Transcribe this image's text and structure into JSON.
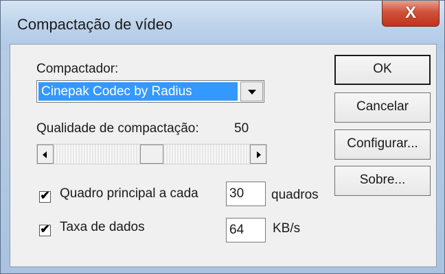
{
  "window": {
    "title": "Compactação de vídeo",
    "close_glyph": "X"
  },
  "compressor": {
    "label": "Compactador:",
    "selected": "Cinepak Codec by Radius"
  },
  "quality": {
    "label": "Qualidade de compactação:",
    "value": "50",
    "slider_fraction": 0.5
  },
  "keyframe": {
    "checked": true,
    "label": "Quadro principal a cada",
    "value": "30",
    "unit": "quadros"
  },
  "datarate": {
    "checked": true,
    "label": "Taxa de dados",
    "value": "64",
    "unit": "KB/s"
  },
  "buttons": {
    "ok": "OK",
    "cancel": "Cancelar",
    "configure": "Configurar...",
    "about": "Sobre..."
  },
  "icons": {
    "checkmark": "✔",
    "combo_arrow": "chevron-down-icon",
    "scroll_left": "chevron-left-icon",
    "scroll_right": "chevron-right-icon"
  }
}
